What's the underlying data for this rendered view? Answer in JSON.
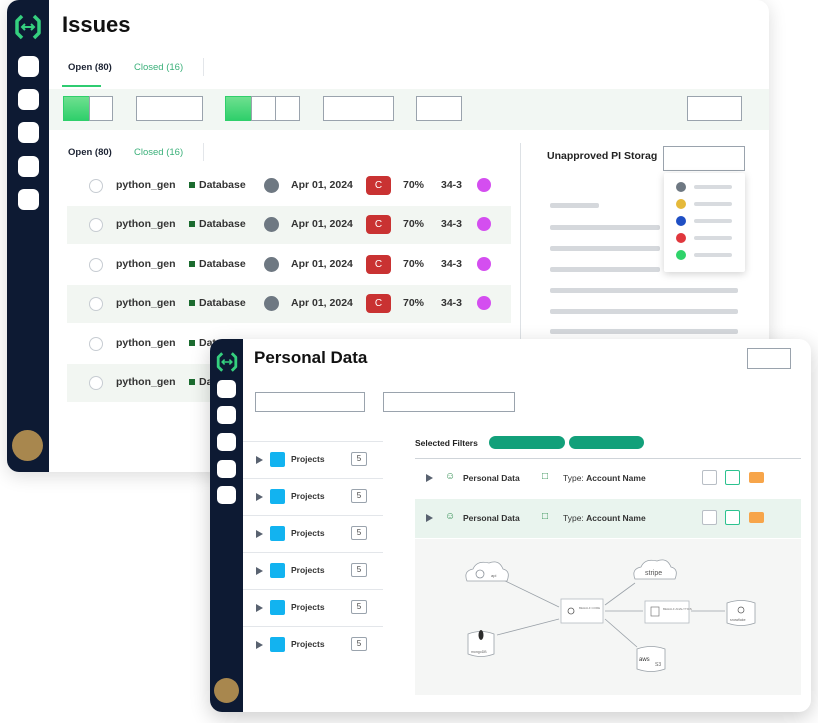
{
  "back_window": {
    "title": "Issues",
    "tabs": [
      {
        "label": "Open (80)"
      },
      {
        "label": "Closed (16)"
      }
    ],
    "inner_tabs": [
      {
        "label": "Open (80)"
      },
      {
        "label": "Closed (16)"
      }
    ],
    "issues": [
      {
        "name": "python_gen",
        "category": "Database",
        "date": "Apr 01, 2024",
        "severity": "C",
        "percent": "70%",
        "code": "34-3"
      },
      {
        "name": "python_gen",
        "category": "Database",
        "date": "Apr 01, 2024",
        "severity": "C",
        "percent": "70%",
        "code": "34-3"
      },
      {
        "name": "python_gen",
        "category": "Database",
        "date": "Apr 01, 2024",
        "severity": "C",
        "percent": "70%",
        "code": "34-3"
      },
      {
        "name": "python_gen",
        "category": "Database",
        "date": "Apr 01, 2024",
        "severity": "C",
        "percent": "70%",
        "code": "34-3"
      },
      {
        "name": "python_gen",
        "category": "Dat",
        "date": "",
        "severity": "",
        "percent": "",
        "code": ""
      },
      {
        "name": "python_gen",
        "category": "Da",
        "date": "",
        "severity": "",
        "percent": "",
        "code": ""
      }
    ],
    "panel": {
      "title": "Unapproved PI Storag",
      "legend_colors": [
        "#6e7882",
        "#e5b93a",
        "#1f4fc4",
        "#e0373d",
        "#2fd36a"
      ]
    }
  },
  "front_window": {
    "title": "Personal Data",
    "projects": [
      {
        "label": "Projects",
        "count": "5"
      },
      {
        "label": "Projects",
        "count": "5"
      },
      {
        "label": "Projects",
        "count": "5"
      },
      {
        "label": "Projects",
        "count": "5"
      },
      {
        "label": "Projects",
        "count": "5"
      },
      {
        "label": "Projects",
        "count": "5"
      }
    ],
    "selected_filters_label": "Selected Filters",
    "rows": [
      {
        "label": "Personal Data",
        "type_prefix": "Type:",
        "type_value": "Account Name"
      },
      {
        "label": "Personal Data",
        "type_prefix": "Type:",
        "type_value": "Account Name"
      }
    ],
    "flow": {
      "api_label": "api",
      "mongo_label": "mongoDB",
      "center_label": "BEHALF CORE",
      "stripe_label": "stripe",
      "analytics_label": "BEHALF ANALYTICS",
      "snowflake_label": "snowflake",
      "aws_label": "aws",
      "s3_label": "S3"
    }
  },
  "colors": {
    "sidebar": "#0d1a33",
    "accent_green": "#2fcf6b",
    "severity_red": "#c93232",
    "pill_teal": "#12a07a",
    "purple_dot": "#d44ef0",
    "project_blue": "#12b3f0",
    "orange_badge": "#f7a54a"
  }
}
